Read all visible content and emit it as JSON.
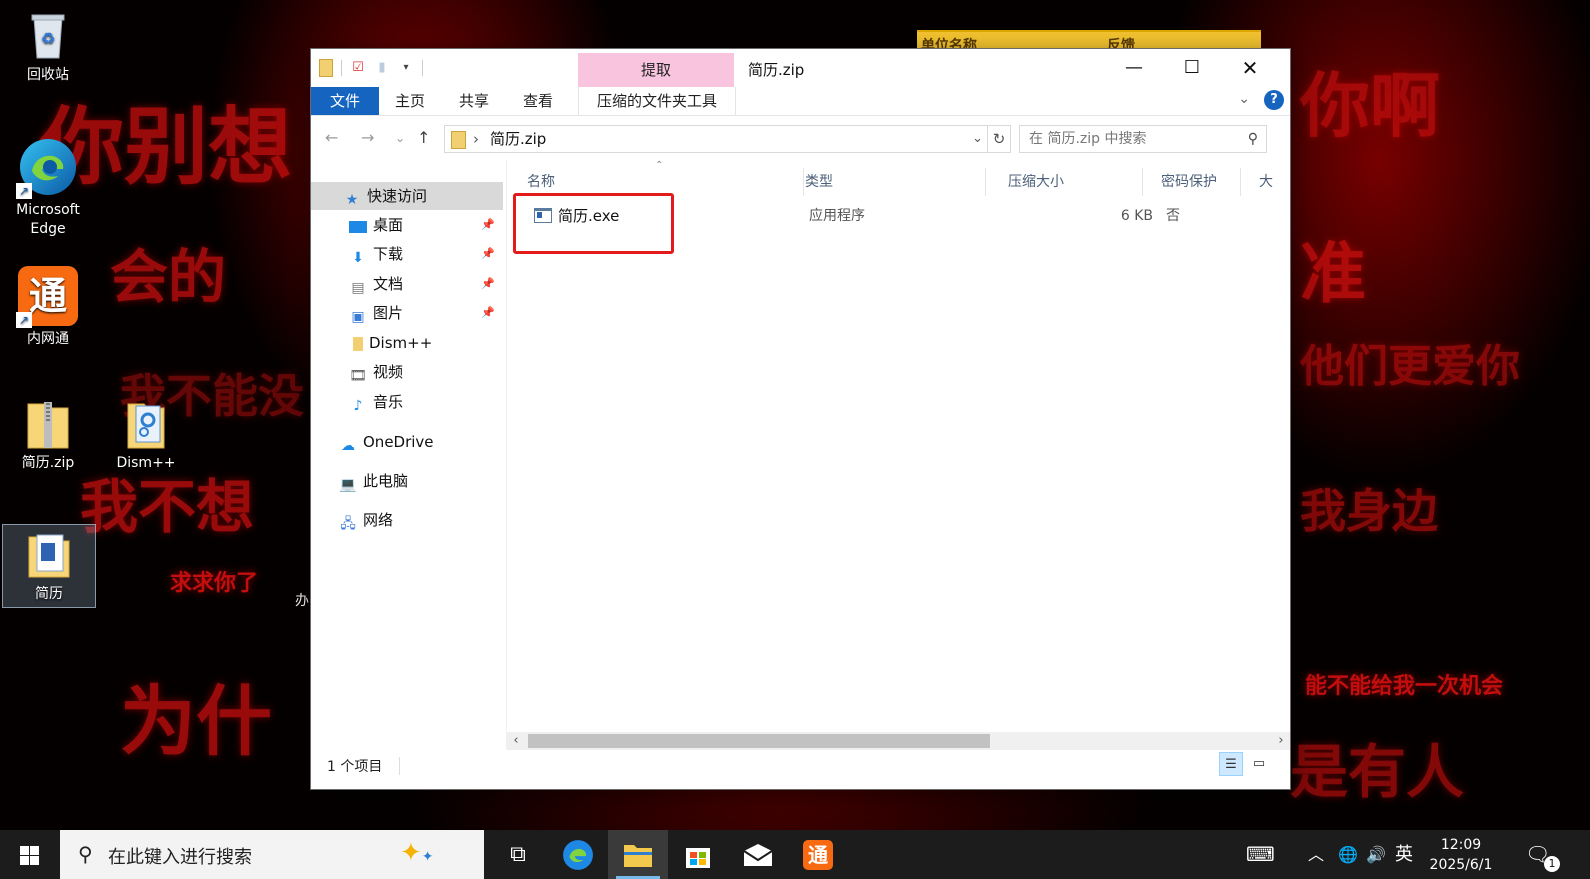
{
  "wallpaper": {
    "texts": [
      "你别想",
      "你啊",
      "会的",
      "准",
      "我不能没",
      "他们更爱你",
      "我不想",
      "我身边",
      "求求你了",
      "能不能给我一次机会",
      "为什",
      "是有人"
    ]
  },
  "desktop": {
    "icons": [
      {
        "label": "回收站",
        "icon": "recycle-bin-icon"
      },
      {
        "label": "Microsoft Edge",
        "icon": "edge-icon"
      },
      {
        "label": "内网通",
        "icon": "neiwangtong-icon",
        "glyph": "通"
      },
      {
        "label": "简历.zip",
        "icon": "zip-folder-icon"
      },
      {
        "label": "Dism++",
        "icon": "dism-folder-icon"
      },
      {
        "label": "简历",
        "icon": "folder-icon"
      }
    ],
    "partial_label": "办",
    "background_notice": {
      "left": "单位名称",
      "right": "反馈"
    }
  },
  "window": {
    "title": "简历.zip",
    "context_tab_group": "提取",
    "ribbon_tabs": [
      "文件",
      "主页",
      "共享",
      "查看"
    ],
    "context_tab": "压缩的文件夹工具",
    "help": "?",
    "address": {
      "path": "简历.zip",
      "search_placeholder": "在 简历.zip 中搜索"
    },
    "nav_pane": {
      "quick_access": "快速访问",
      "items": [
        {
          "label": "桌面",
          "icon": "desktop-icon",
          "pinned": true
        },
        {
          "label": "下载",
          "icon": "download-icon",
          "pinned": true
        },
        {
          "label": "文档",
          "icon": "documents-icon",
          "pinned": true
        },
        {
          "label": "图片",
          "icon": "pictures-icon",
          "pinned": true
        },
        {
          "label": "Dism++",
          "icon": "folder-icon",
          "pinned": false
        },
        {
          "label": "视频",
          "icon": "videos-icon",
          "pinned": false
        },
        {
          "label": "音乐",
          "icon": "music-icon",
          "pinned": false
        }
      ],
      "onedrive": "OneDrive",
      "this_pc": "此电脑",
      "network": "网络"
    },
    "columns": [
      "名称",
      "类型",
      "压缩大小",
      "密码保护",
      "大"
    ],
    "files": [
      {
        "name": "简历.exe",
        "type": "应用程序",
        "compressed_size": "6 KB",
        "password": "否"
      }
    ],
    "status": "1 个项目"
  },
  "taskbar": {
    "search_placeholder": "在此键入进行搜索",
    "apps": [
      "task-view-icon",
      "edge-icon",
      "file-explorer-icon",
      "store-icon",
      "mail-icon",
      "neiwangtong-icon"
    ],
    "tray": {
      "ime": "英",
      "time": "12:09",
      "date": "2025/6/1",
      "notifications": "1"
    }
  },
  "colors": {
    "accent": "#1565c0",
    "context_tab": "#f9c4de",
    "highlight_box": "#e31b1b"
  }
}
